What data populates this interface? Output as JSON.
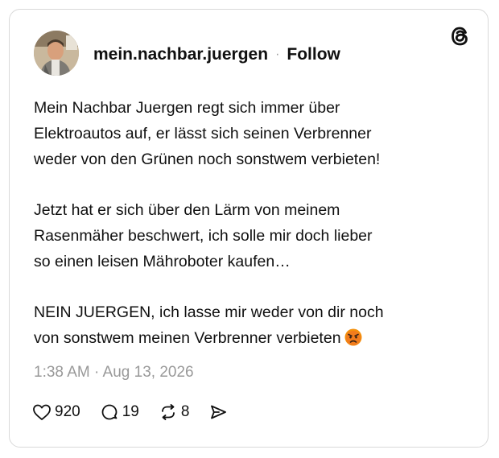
{
  "post": {
    "username": "mein.nachbar.juergen",
    "separator": "·",
    "follow_label": "Follow",
    "paragraphs": [
      "Mein Nachbar Juergen regt sich immer über\nElektroautos auf, er lässt sich seinen Verbrenner\nweder von den Grünen noch sonstwem verbieten!",
      "Jetzt hat er sich über den Lärm von meinem\nRasenmäher beschwert, ich solle mir doch lieber\nso einen leisen Mähroboter kaufen…",
      "NEIN JUERGEN, ich lasse mir weder von dir noch\nvon sonstwem meinen Verbrenner verbieten"
    ],
    "emoji": "angry-face-emoji",
    "timestamp": "1:38 AM · Aug 13, 2026"
  },
  "actions": {
    "likes": "920",
    "replies": "19",
    "reposts": "8",
    "like_icon": "heart-icon",
    "reply_icon": "comment-bubble-icon",
    "repost_icon": "repost-arrows-icon",
    "share_icon": "send-icon"
  },
  "brand": {
    "logo": "threads-logo-icon"
  },
  "colors": {
    "text": "#101010",
    "muted": "#999999",
    "border": "#d9d9d9",
    "emoji": "#f4900c"
  }
}
